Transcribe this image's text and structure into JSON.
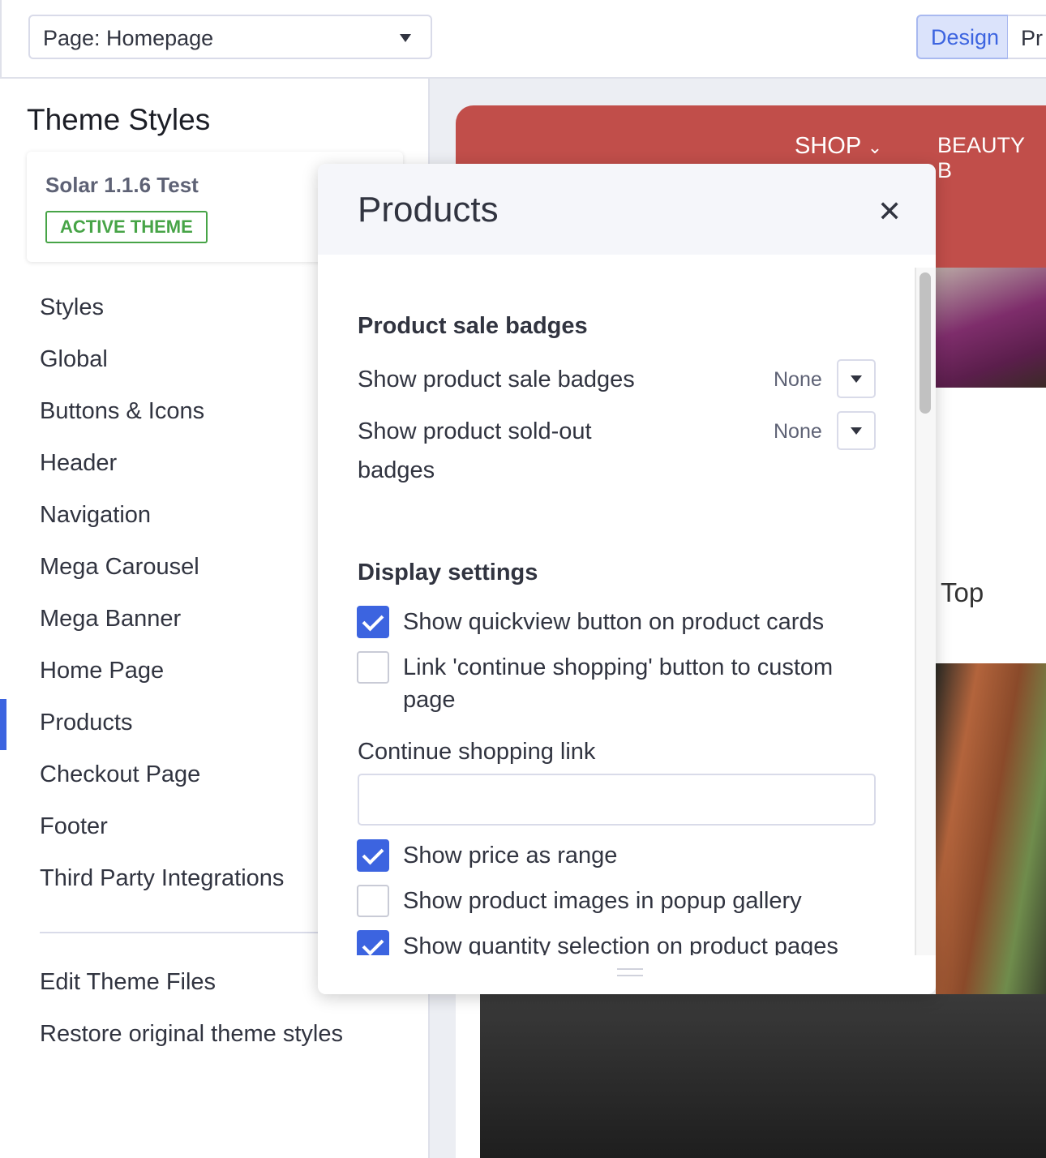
{
  "topbar": {
    "page_select": "Page: Homepage",
    "design": "Design",
    "preview": "Preview"
  },
  "sidebar": {
    "title": "Theme Styles",
    "theme_name": "Solar 1.1.6 Test",
    "active_badge": "ACTIVE THEME",
    "items": [
      "Styles",
      "Global",
      "Buttons & Icons",
      "Header",
      "Navigation",
      "Mega Carousel",
      "Mega Banner",
      "Home Page",
      "Products",
      "Checkout Page",
      "Footer",
      "Third Party Integrations"
    ],
    "active_item": "Products",
    "accent": "#3c64e0",
    "footer_items": [
      "Edit Theme Files",
      "Restore original theme styles"
    ]
  },
  "preview": {
    "nav": [
      "SHOP",
      "BEAUTY B"
    ],
    "top_products": "Top products",
    "brand_color": "#c14e4a"
  },
  "modal": {
    "title": "Products",
    "sale_section": "Product sale badges",
    "sale_badges_label": "Show product sale badges",
    "sale_badges_value": "None",
    "soldout_label": "Show product sold-out badges",
    "soldout_value": "None",
    "display_section": "Display settings",
    "checks": [
      {
        "label": "Show quickview button on product cards",
        "checked": true
      },
      {
        "label": "Link 'continue shopping' button to custom page",
        "checked": false
      },
      {
        "label": "Show price as range",
        "checked": true
      },
      {
        "label": "Show product images in popup gallery",
        "checked": false
      },
      {
        "label": "Show quantity selection on product pages",
        "checked": true
      }
    ],
    "continue_link_label": "Continue shopping link",
    "continue_link_value": ""
  }
}
